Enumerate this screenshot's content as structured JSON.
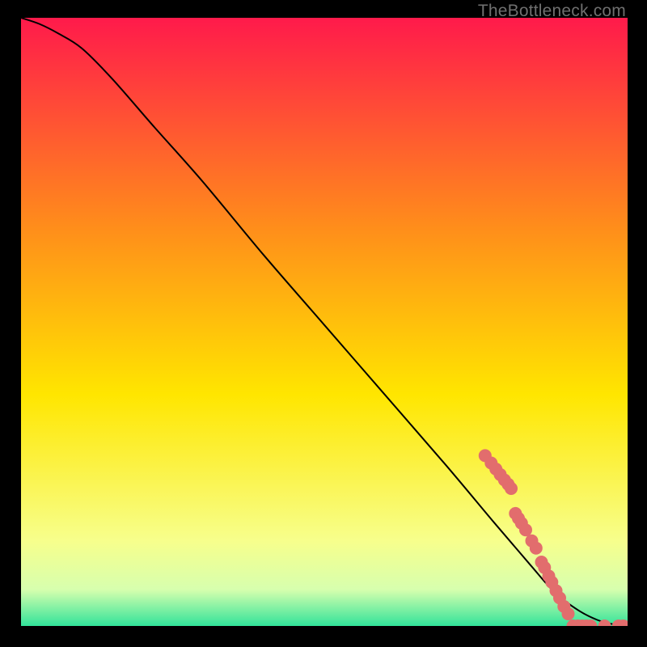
{
  "watermark": "TheBottleneck.com",
  "chart_data": {
    "type": "line",
    "title": "",
    "xlabel": "",
    "ylabel": "",
    "xlim": [
      0,
      100
    ],
    "ylim": [
      0,
      100
    ],
    "grid": false,
    "legend": false,
    "background_gradient": {
      "top": "#ff1a4b",
      "mid1": "#ff8f1a",
      "mid2": "#ffe600",
      "mid3": "#f7ff8c",
      "mid4": "#d7ffae",
      "bottom": "#32e39a"
    },
    "curve": {
      "x": [
        0,
        3,
        6,
        10,
        15,
        22,
        30,
        40,
        50,
        60,
        70,
        78,
        84,
        88,
        92,
        95,
        97.5,
        100
      ],
      "y": [
        100,
        99,
        97.5,
        95,
        90,
        82,
        73,
        61,
        49.5,
        38,
        26.5,
        17,
        10,
        5.5,
        2.5,
        1,
        0.3,
        0
      ],
      "note": "Monotone descending curve; slight convex shoulder near top-left, near-linear through middle, flattening to zero at far right."
    },
    "markers": {
      "color": "#e26d6d",
      "radius_px": 8,
      "points": [
        {
          "x": 76.5,
          "y": 28.0
        },
        {
          "x": 77.5,
          "y": 26.8
        },
        {
          "x": 78.3,
          "y": 25.8
        },
        {
          "x": 79.0,
          "y": 24.9
        },
        {
          "x": 79.7,
          "y": 24.0
        },
        {
          "x": 80.3,
          "y": 23.3
        },
        {
          "x": 80.8,
          "y": 22.6
        },
        {
          "x": 81.5,
          "y": 18.5
        },
        {
          "x": 82.0,
          "y": 17.7
        },
        {
          "x": 82.5,
          "y": 16.9
        },
        {
          "x": 83.2,
          "y": 15.8
        },
        {
          "x": 84.2,
          "y": 14.0
        },
        {
          "x": 84.9,
          "y": 12.8
        },
        {
          "x": 85.8,
          "y": 10.5
        },
        {
          "x": 86.3,
          "y": 9.6
        },
        {
          "x": 87.0,
          "y": 8.2
        },
        {
          "x": 87.5,
          "y": 7.2
        },
        {
          "x": 88.2,
          "y": 5.8
        },
        {
          "x": 88.8,
          "y": 4.6
        },
        {
          "x": 89.5,
          "y": 3.2
        },
        {
          "x": 90.2,
          "y": 2.0
        },
        {
          "x": 91.0,
          "y": 0.0
        },
        {
          "x": 91.8,
          "y": 0.0
        },
        {
          "x": 92.5,
          "y": 0.0
        },
        {
          "x": 93.2,
          "y": 0.0
        },
        {
          "x": 93.9,
          "y": 0.0
        },
        {
          "x": 96.2,
          "y": 0.0
        },
        {
          "x": 98.5,
          "y": 0.0
        },
        {
          "x": 99.3,
          "y": 0.0
        }
      ]
    }
  }
}
